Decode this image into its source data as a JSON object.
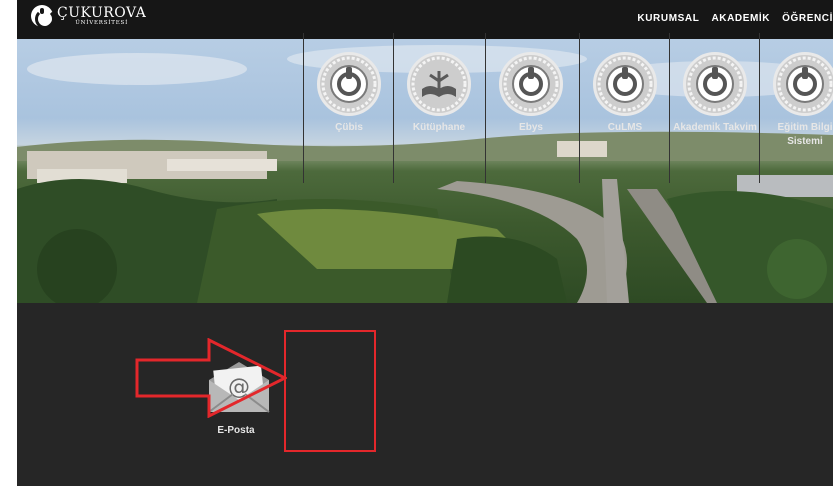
{
  "header": {
    "logo_name": "ÇUKUROVA",
    "logo_sub": "ÜNİVERSİTESİ",
    "nav": [
      "KURUMSAL",
      "AKADEMİK",
      "ÖĞRENCİ"
    ]
  },
  "apps": [
    {
      "label": "E-Posta",
      "icon": "mail-icon"
    },
    {
      "label": "Çübis",
      "icon": "university-seal-icon"
    },
    {
      "label": "Kütüphane",
      "icon": "library-book-icon"
    },
    {
      "label": "Ebys",
      "icon": "university-seal-icon"
    },
    {
      "label": "CuLMS",
      "icon": "university-seal-icon"
    },
    {
      "label": "Akademik Takvim",
      "icon": "university-seal-icon"
    },
    {
      "label": "Eğitim Bilgi Sistemi",
      "icon": "university-seal-icon"
    }
  ],
  "colors": {
    "topbar": "#161616",
    "strip": "#262626",
    "annotation": "#e3272b"
  }
}
